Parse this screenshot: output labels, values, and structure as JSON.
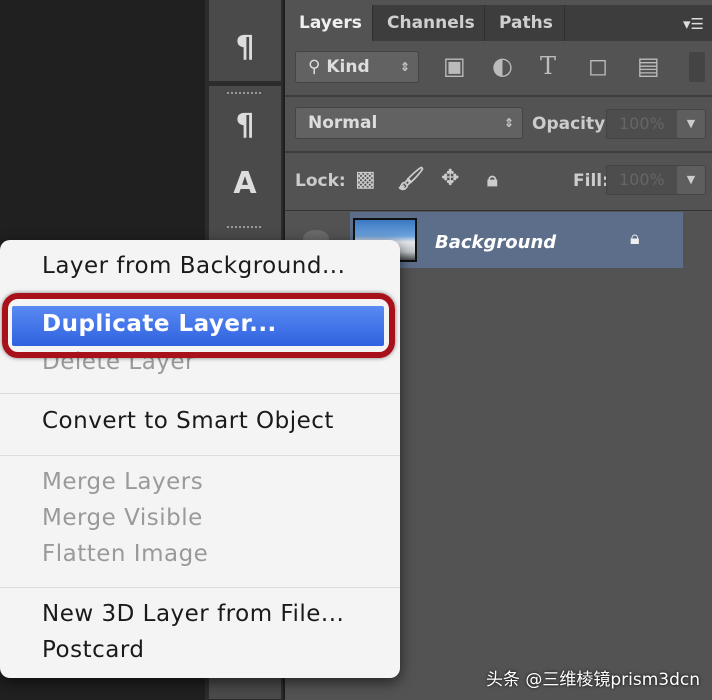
{
  "tabs": [
    "Layers",
    "Channels",
    "Paths"
  ],
  "filter": {
    "kind_label": "Kind"
  },
  "blend": {
    "mode": "Normal",
    "opacity_label": "Opacity:",
    "opacity_value": "100%"
  },
  "lock": {
    "label": "Lock:",
    "fill_label": "Fill:",
    "fill_value": "100%"
  },
  "layer": {
    "name": "Background"
  },
  "context_menu": {
    "items": [
      "Layer from Background...",
      "Duplicate Layer...",
      "Delete Layer",
      "Convert to Smart Object",
      "Merge Layers",
      "Merge Visible",
      "Flatten Image",
      "New 3D Layer from File...",
      "Postcard"
    ],
    "highlighted": "Duplicate Layer..."
  },
  "watermark": "头条 @三维棱镜prism3dcn",
  "colors": {
    "highlight": "#2f62e0",
    "ring": "#a8101a",
    "panel": "#535353"
  }
}
